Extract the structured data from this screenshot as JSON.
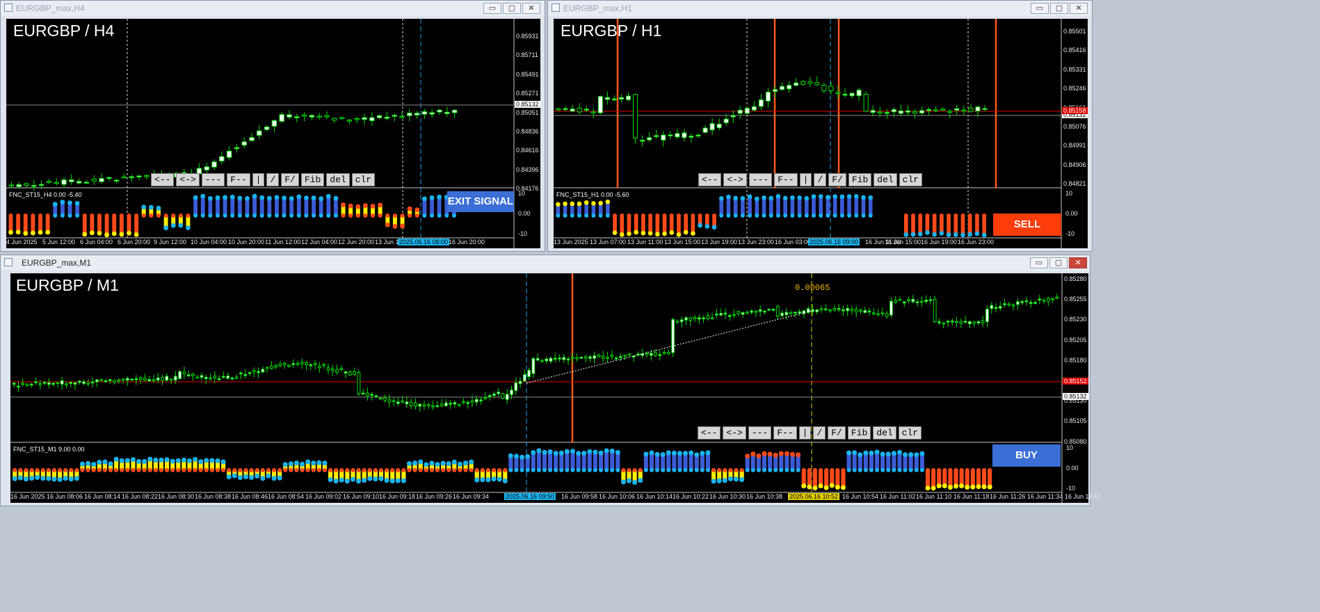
{
  "windows": {
    "h4": {
      "title": "EURGBP_max,H4",
      "symbol": "EURGBP / H4",
      "indicator": "FNC_ST15_H4 0.00 -5.40",
      "signal": "EXIT SIGNAL",
      "signal_color": "#3b6fd6",
      "price_levels": [
        "0.85931",
        "0.85711",
        "0.85491",
        "0.85271",
        "0.85051",
        "0.84836",
        "0.84616",
        "0.84396",
        "0.84176"
      ],
      "current_price": "0.85132",
      "ind_levels": [
        "10",
        "0.00",
        "-10"
      ],
      "time_labels": [
        "4 Jun 2025",
        "5 Jun 12:00",
        "6 Jun 04:00",
        "6 Jun 20:00",
        "9 Jun 12:00",
        "10 Jun 04:00",
        "10 Jun 20:00",
        "11 Jun 12:00",
        "12 Jun 04:00",
        "12 Jun 20:00",
        "13 Jun 12",
        "16 Jun 20:00"
      ],
      "time_highlight": "2025.06.16 08:00"
    },
    "h1": {
      "title": "EURGBP_max,H1",
      "symbol": "EURGBP / H1",
      "indicator": "FNC_ST15_H1 0.00 -5.60",
      "signal": "SELL",
      "signal_color": "#ff3d0a",
      "price_levels": [
        "0.85501",
        "0.85416",
        "0.85331",
        "0.85246",
        "0.85161",
        "0.85076",
        "0.84991",
        "0.84906",
        "0.84821"
      ],
      "current_price": "0.85132",
      "red_price": "0.85158",
      "ind_levels": [
        "10",
        "0.00",
        "-10"
      ],
      "time_labels": [
        "13 Jun 2025",
        "13 Jun 07:00",
        "13 Jun 11:00",
        "13 Jun 15:00",
        "13 Jun 19:00",
        "13 Jun 23:00",
        "16 Jun 03:00",
        "16 Jun 11:00",
        "16 Jun 15:00",
        "16 Jun 19:00",
        "16 Jun 23:00"
      ],
      "time_highlight": "2025.06.16 09:00"
    },
    "m1": {
      "title": "EURGBP_max,M1",
      "symbol": "EURGBP / M1",
      "indicator": "FNC_ST15_M1 9.00 0.00",
      "signal": "BUY",
      "signal_color": "#3b6fd6",
      "price_levels": [
        "0.85280",
        "0.85255",
        "0.85230",
        "0.85205",
        "0.85180",
        "0.85155",
        "0.85130",
        "0.85105",
        "0.85080"
      ],
      "current_price": "0.85132",
      "red_price": "0.85152",
      "ind_levels": [
        "10",
        "0.00",
        "-10"
      ],
      "annotation": "0.00065",
      "time_labels": [
        "16 Jun 2025",
        "16 Jun 08:06",
        "16 Jun 08:14",
        "16 Jun 08:22",
        "16 Jun 08:30",
        "16 Jun 08:38",
        "16 Jun 08:46",
        "16 Jun 08:54",
        "16 Jun 09:02",
        "16 Jun 09:10",
        "16 Jun 09:18",
        "16 Jun 09:26",
        "16 Jun 09:34",
        "16 Jun 09:58",
        "16 Jun 10:06",
        "16 Jun 10:14",
        "16 Jun 10:22",
        "16 Jun 10:30",
        "16 Jun 10:38",
        "16 Jun 10:54",
        "16 Jun 11:02",
        "16 Jun 11:10",
        "16 Jun 11:18",
        "16 Jun 11:26",
        "16 Jun 11:34",
        "16 Jun 11:42"
      ],
      "time_highlight": "2025.06.16 09:50",
      "time_highlight2": "2025.06.16 10:52"
    }
  },
  "toolbar": [
    "<--",
    "<->",
    "---",
    "F--",
    "|",
    "/",
    "F/",
    "Fib",
    "del",
    "clr"
  ],
  "window_buttons": {
    "min": "▭",
    "max": "▢",
    "close": "✕"
  },
  "colors": {
    "bull": "#ffffff",
    "bear": "#000000",
    "wick": "#00e000",
    "ind_blue": "#3b5bd6",
    "ind_yellow": "#ffee00",
    "ind_red": "#ff4a1a",
    "dot_cyan": "#19b4f0"
  }
}
